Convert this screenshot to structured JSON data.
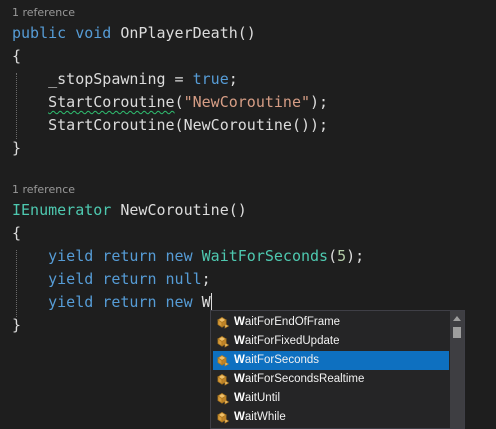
{
  "codelens": {
    "first": "1 reference",
    "second": "1 reference"
  },
  "code": {
    "method1": {
      "modifier": "public",
      "return_type": "void",
      "name": "OnPlayerDeath()",
      "open_brace": "{",
      "close_brace": "}",
      "stmt1": {
        "field": "_stopSpawning = ",
        "value": "true",
        "end": ";"
      },
      "stmt2": {
        "call": "StartCoroutine",
        "open": "(",
        "arg": "\"NewCoroutine\"",
        "close": ");"
      },
      "stmt3": {
        "text": "StartCoroutine(NewCoroutine());"
      }
    },
    "method2": {
      "return_type": "IEnumerator",
      "name": " NewCoroutine()",
      "open_brace": "{",
      "close_brace": "}",
      "yield1": {
        "kw1": "yield",
        "kw2": "return",
        "kw3": "new",
        "cls": "WaitForSeconds",
        "open": "(",
        "num": "5",
        "close": ");"
      },
      "yield2": {
        "kw1": "yield",
        "kw2": "return",
        "kw3": "null",
        "end": ";"
      },
      "yield3": {
        "kw1": "yield",
        "kw2": "return",
        "kw3": "new",
        "typed": "W"
      }
    }
  },
  "completion": {
    "icon": "class-icon",
    "selected_index": 2,
    "items": [
      {
        "match": "W",
        "rest": "aitForEndOfFrame"
      },
      {
        "match": "W",
        "rest": "aitForFixedUpdate"
      },
      {
        "match": "W",
        "rest": "aitForSeconds"
      },
      {
        "match": "W",
        "rest": "aitForSecondsRealtime"
      },
      {
        "match": "W",
        "rest": "aitUntil"
      },
      {
        "match": "W",
        "rest": "aitWhile"
      }
    ]
  },
  "colors": {
    "background": "#1e1e1e",
    "keyword": "#569cd6",
    "string": "#d69d85",
    "number": "#b5cea8",
    "type": "#4ec9b0",
    "selection": "#0e70c0"
  }
}
